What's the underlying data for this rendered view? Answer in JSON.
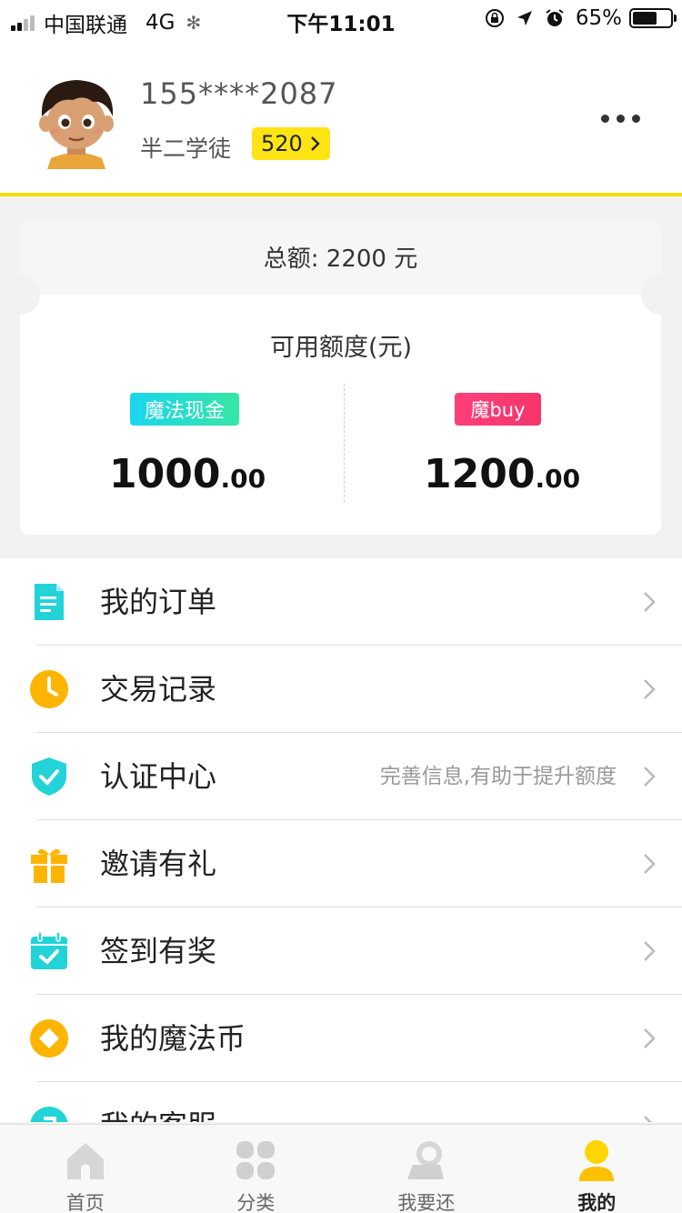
{
  "status_bar": {
    "carrier": "中国联通",
    "network": "4G",
    "time": "下午11:01",
    "battery": "65%"
  },
  "profile": {
    "phone": "155****2087",
    "level": "半二学徒",
    "points": "520"
  },
  "credit": {
    "total_label": "总额: 2200 元",
    "available_label": "可用额度(元)",
    "cash": {
      "tag": "魔法现金",
      "amount_int": "1000",
      "amount_dec": ".00"
    },
    "buy": {
      "tag": "魔buy",
      "amount_int": "1200",
      "amount_dec": ".00"
    }
  },
  "menu": [
    {
      "label": "我的订单",
      "icon": "order-doc-icon",
      "color": "#22d3d8"
    },
    {
      "label": "交易记录",
      "icon": "clock-icon",
      "color": "#ffb400"
    },
    {
      "label": "认证中心",
      "icon": "shield-check-icon",
      "color": "#22d3d8",
      "hint": "完善信息,有助于提升额度"
    },
    {
      "label": "邀请有礼",
      "icon": "gift-icon",
      "color": "#ffb400"
    },
    {
      "label": "签到有奖",
      "icon": "calendar-check-icon",
      "color": "#22d3d8"
    },
    {
      "label": "我的魔法币",
      "icon": "coin-icon",
      "color": "#ffb400"
    },
    {
      "label": "我的客服",
      "icon": "customer-service-icon",
      "color": "#22d3d8"
    }
  ],
  "tabbar": [
    {
      "label": "首页",
      "icon": "home-icon"
    },
    {
      "label": "分类",
      "icon": "category-icon"
    },
    {
      "label": "我要还",
      "icon": "repay-icon"
    },
    {
      "label": "我的",
      "icon": "profile-icon",
      "active": true
    }
  ],
  "colors": {
    "brand_yellow": "#ffe415",
    "accent_cyan": "#22d3d8",
    "accent_orange": "#ffb400",
    "buy_pink": "#ff3f7a"
  }
}
